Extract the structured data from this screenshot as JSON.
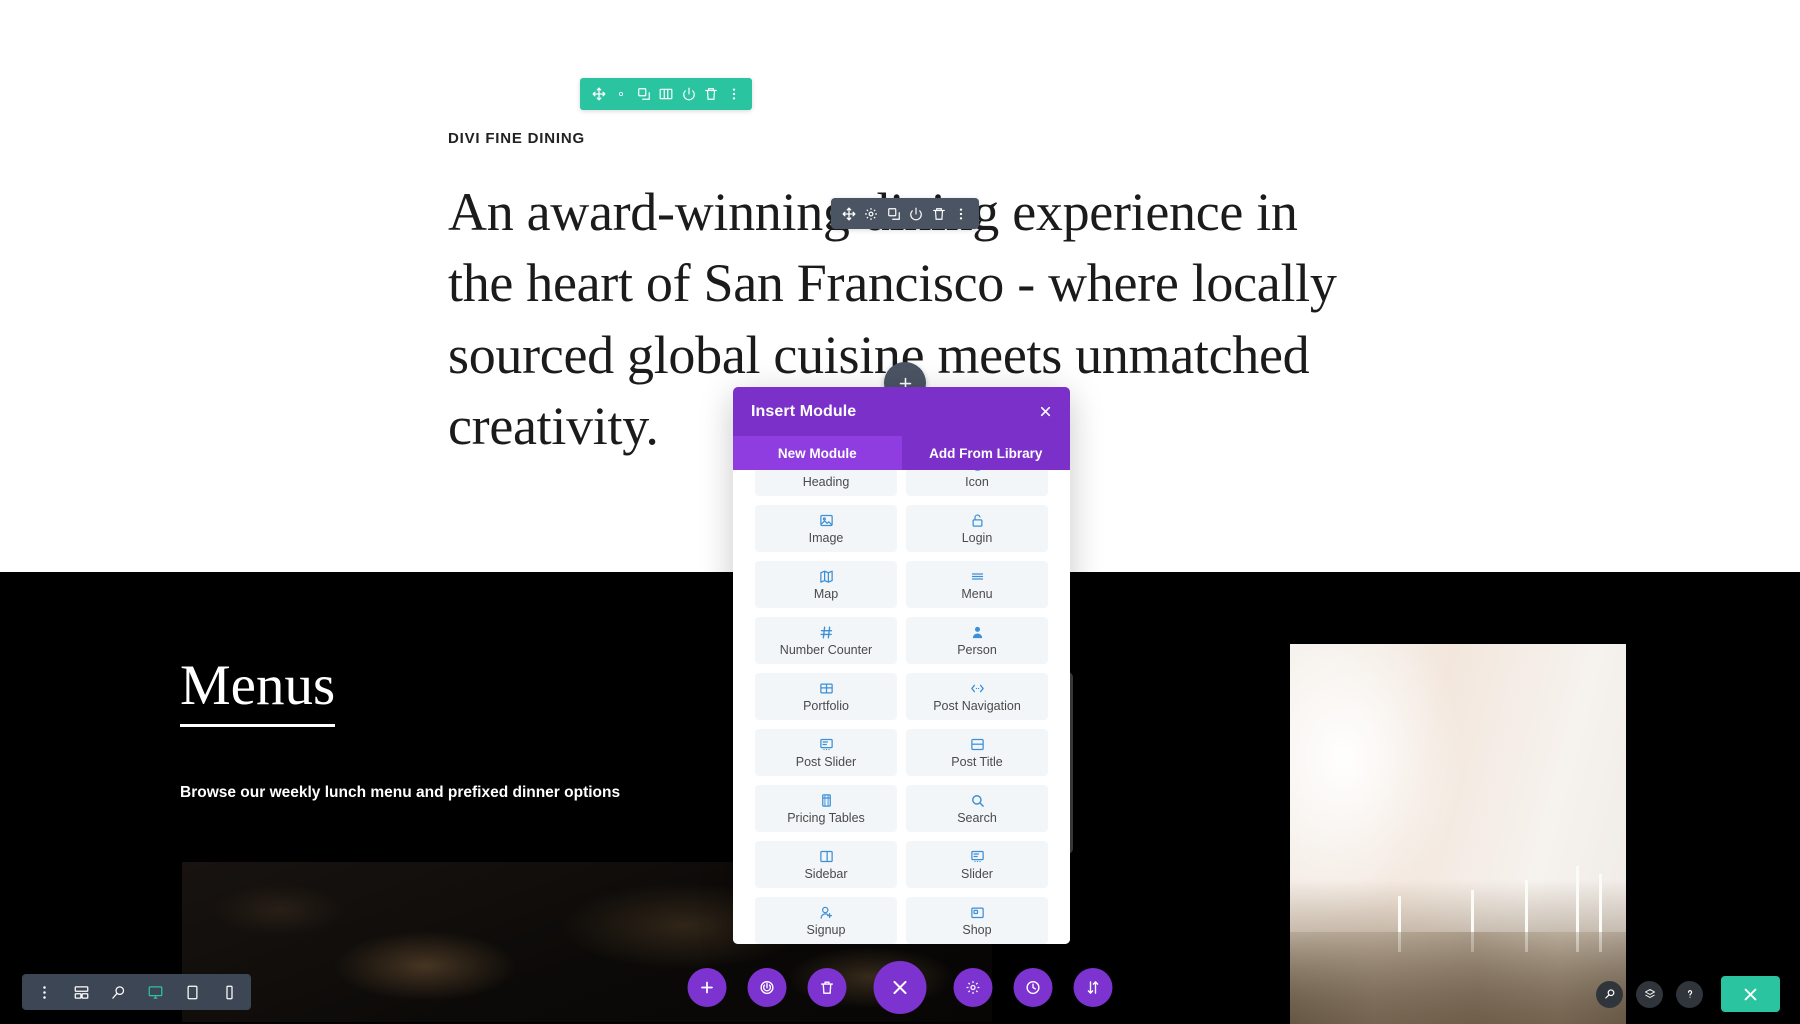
{
  "hero": {
    "eyebrow": "DIVI FINE DINING",
    "heading": "An award-winning dining experience in the heart of San Francisco - where locally sourced global cuisine meets unmatched creativity."
  },
  "dark_section": {
    "title": "Menus",
    "subtitle": "Browse our weekly lunch menu and prefixed dinner options"
  },
  "section_toolbar": {
    "color": "#2ac4a1",
    "items": [
      {
        "name": "move-icon",
        "label": "Move"
      },
      {
        "name": "gear-icon",
        "label": "Settings"
      },
      {
        "name": "duplicate-icon",
        "label": "Duplicate"
      },
      {
        "name": "columns-icon",
        "label": "Columns"
      },
      {
        "name": "power-icon",
        "label": "Disable"
      },
      {
        "name": "trash-icon",
        "label": "Delete"
      },
      {
        "name": "kebab-menu-icon",
        "label": "More Options"
      }
    ]
  },
  "module_toolbar": {
    "color": "#4a5463",
    "items": [
      {
        "name": "move-icon",
        "label": "Move"
      },
      {
        "name": "gear-icon",
        "label": "Settings"
      },
      {
        "name": "duplicate-icon",
        "label": "Duplicate"
      },
      {
        "name": "power-icon",
        "label": "Disable"
      },
      {
        "name": "trash-icon",
        "label": "Delete"
      },
      {
        "name": "kebab-menu-icon",
        "label": "More Options"
      }
    ]
  },
  "add_handle": {
    "label": "Add New Module",
    "icon": "plus-icon"
  },
  "modal": {
    "title": "Insert Module",
    "close_label": "×",
    "accent": "#7b31c9",
    "tabs": [
      {
        "label": "New Module",
        "active": true
      },
      {
        "label": "Add From Library",
        "active": false
      }
    ],
    "modules": [
      {
        "label": "Heading",
        "icon": "heading-icon"
      },
      {
        "label": "Icon",
        "icon": "target-icon"
      },
      {
        "label": "Image",
        "icon": "image-icon"
      },
      {
        "label": "Login",
        "icon": "lock-icon"
      },
      {
        "label": "Map",
        "icon": "map-icon"
      },
      {
        "label": "Menu",
        "icon": "hamburger-icon"
      },
      {
        "label": "Number Counter",
        "icon": "hash-icon"
      },
      {
        "label": "Person",
        "icon": "person-icon"
      },
      {
        "label": "Portfolio",
        "icon": "grid-icon"
      },
      {
        "label": "Post Navigation",
        "icon": "code-arrows-icon"
      },
      {
        "label": "Post Slider",
        "icon": "post-slider-icon"
      },
      {
        "label": "Post Title",
        "icon": "post-title-icon"
      },
      {
        "label": "Pricing Tables",
        "icon": "pricing-tables-icon"
      },
      {
        "label": "Search",
        "icon": "search-icon"
      },
      {
        "label": "Sidebar",
        "icon": "sidebar-icon"
      },
      {
        "label": "Slider",
        "icon": "slider-icon"
      },
      {
        "label": "Signup",
        "icon": "person-add-icon"
      },
      {
        "label": "Shop",
        "icon": "shop-icon"
      }
    ]
  },
  "device_toolbar": {
    "items": [
      {
        "name": "kebab-menu-icon",
        "label": "More Settings",
        "active": false
      },
      {
        "name": "wireframe-icon",
        "label": "Wireframe View",
        "active": false
      },
      {
        "name": "zoom-out-icon",
        "label": "Zoom Out View",
        "active": false
      },
      {
        "name": "desktop-icon",
        "label": "Desktop View",
        "active": true
      },
      {
        "name": "tablet-icon",
        "label": "Tablet View",
        "active": false
      },
      {
        "name": "phone-icon",
        "label": "Phone View",
        "active": false
      }
    ]
  },
  "action_bar": {
    "color": "#7c33cf",
    "items": [
      {
        "name": "plus-icon",
        "label": "Add Section",
        "main": false
      },
      {
        "name": "power-icon",
        "label": "Toggle Builder",
        "main": false
      },
      {
        "name": "trash-icon",
        "label": "Clear Layout",
        "main": false
      },
      {
        "name": "close-icon",
        "label": "Close Menu",
        "main": true
      },
      {
        "name": "gear-icon",
        "label": "Page Settings",
        "main": false
      },
      {
        "name": "history-icon",
        "label": "Editing History",
        "main": false
      },
      {
        "name": "sort-icon",
        "label": "Portability",
        "main": false
      }
    ]
  },
  "right_tools": {
    "items": [
      {
        "name": "search-icon",
        "label": "Search"
      },
      {
        "name": "layers-icon",
        "label": "Layers View"
      },
      {
        "name": "help-icon",
        "label": "Help"
      }
    ],
    "close": {
      "name": "close-icon",
      "label": "Exit Visual Builder",
      "color": "#2ac4a1"
    }
  }
}
